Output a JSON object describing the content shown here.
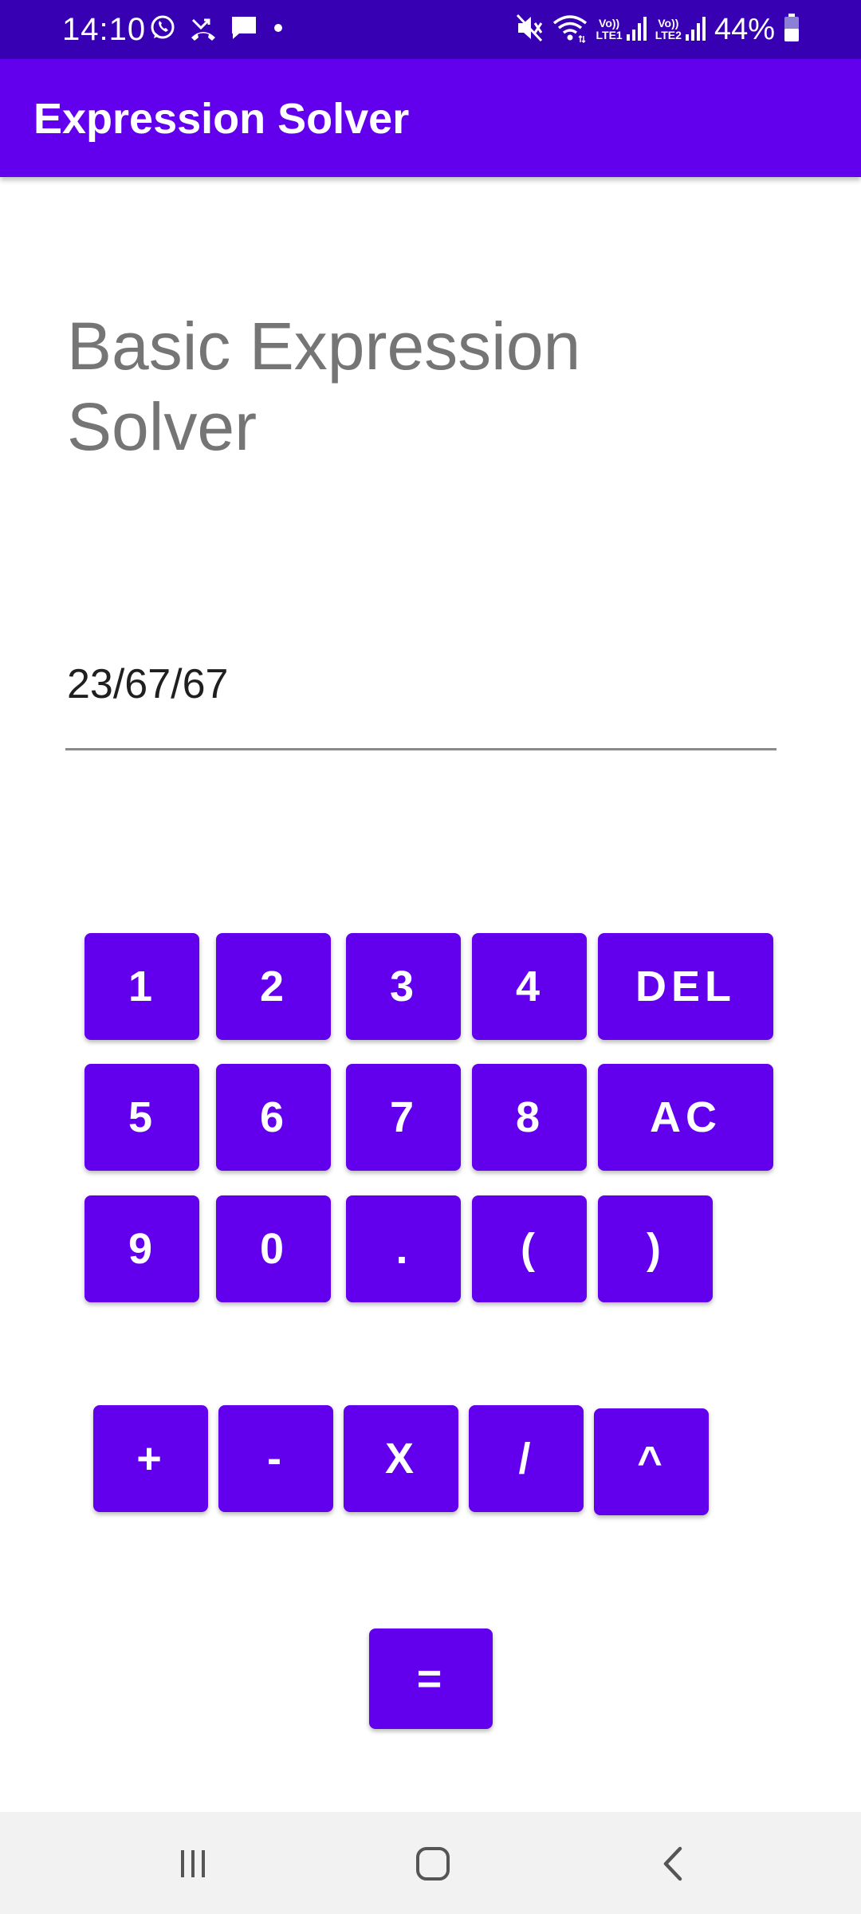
{
  "status_bar": {
    "time": "14:10",
    "battery": "44%",
    "sim1": "LTE1",
    "sim2": "LTE2",
    "volte": "Vo))",
    "left_icons": [
      "whatsapp-icon",
      "missed-call-icon",
      "message-icon",
      "dot-icon"
    ],
    "right_icons": [
      "mute-icon",
      "wifi-icon",
      "signal-icon",
      "signal-icon",
      "battery-icon"
    ]
  },
  "app_bar": {
    "title": "Expression Solver",
    "color": "#6200ee"
  },
  "heading": "Basic Expression Solver",
  "expression": {
    "value": "23/67/67"
  },
  "keypad": {
    "row1": [
      "1",
      "2",
      "3",
      "4",
      "DEL"
    ],
    "row2": [
      "5",
      "6",
      "7",
      "8",
      "AC"
    ],
    "row3": [
      "9",
      "0",
      ".",
      "(",
      ")"
    ],
    "operators": [
      "+",
      "-",
      "X",
      "/",
      "^"
    ],
    "equals": "=",
    "button_color": "#6200ee"
  },
  "nav_bar": {
    "icons": [
      "recents-icon",
      "home-icon",
      "back-icon"
    ]
  }
}
